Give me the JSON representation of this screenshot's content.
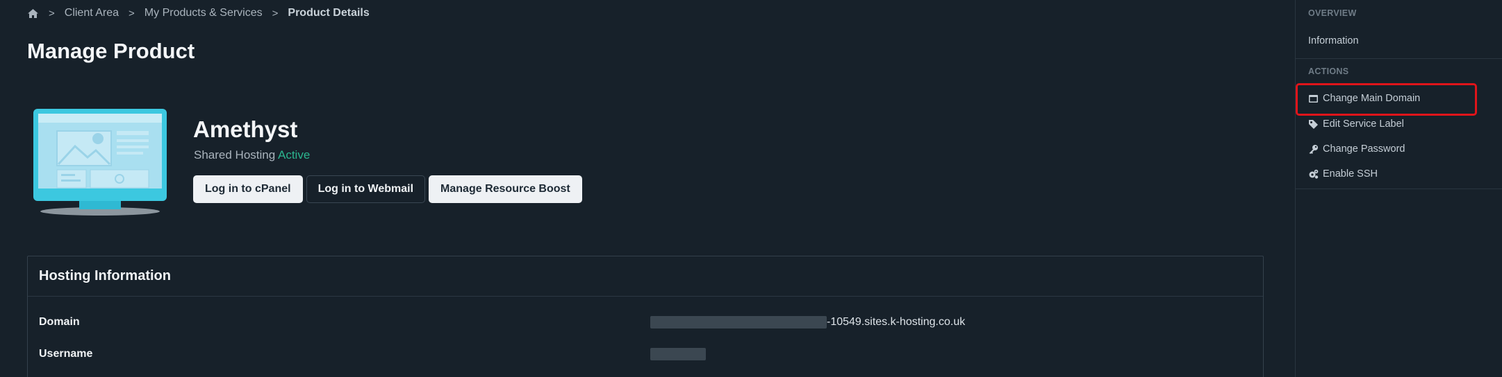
{
  "breadcrumb": {
    "items": [
      "Client Area",
      "My Products & Services"
    ],
    "current": "Product Details",
    "separator": ">"
  },
  "page": {
    "title": "Manage Product"
  },
  "product": {
    "name": "Amethyst",
    "type": "Shared Hosting",
    "status": "Active",
    "status_color": "#2bb58f",
    "buttons": [
      "Log in to cPanel",
      "Log in to Webmail",
      "Manage Resource Boost"
    ]
  },
  "hosting_info": {
    "title": "Hosting Information",
    "rows": [
      {
        "label": "Domain",
        "value_suffix": "-10549.sites.k-hosting.co.uk"
      },
      {
        "label": "Username",
        "value_suffix": ""
      }
    ]
  },
  "sidebar": {
    "overview_heading": "OVERVIEW",
    "overview_items": [
      {
        "label": "Information"
      }
    ],
    "actions_heading": "ACTIONS",
    "actions": [
      {
        "label": "Change Main Domain",
        "icon": "browser-icon"
      },
      {
        "label": "Edit Service Label",
        "icon": "tag-icon"
      },
      {
        "label": "Change Password",
        "icon": "key-icon"
      },
      {
        "label": "Enable SSH",
        "icon": "gears-icon"
      }
    ]
  },
  "colors": {
    "background": "#17212a",
    "highlight": "#e0141a",
    "monitor_accent": "#3cc8e0"
  }
}
